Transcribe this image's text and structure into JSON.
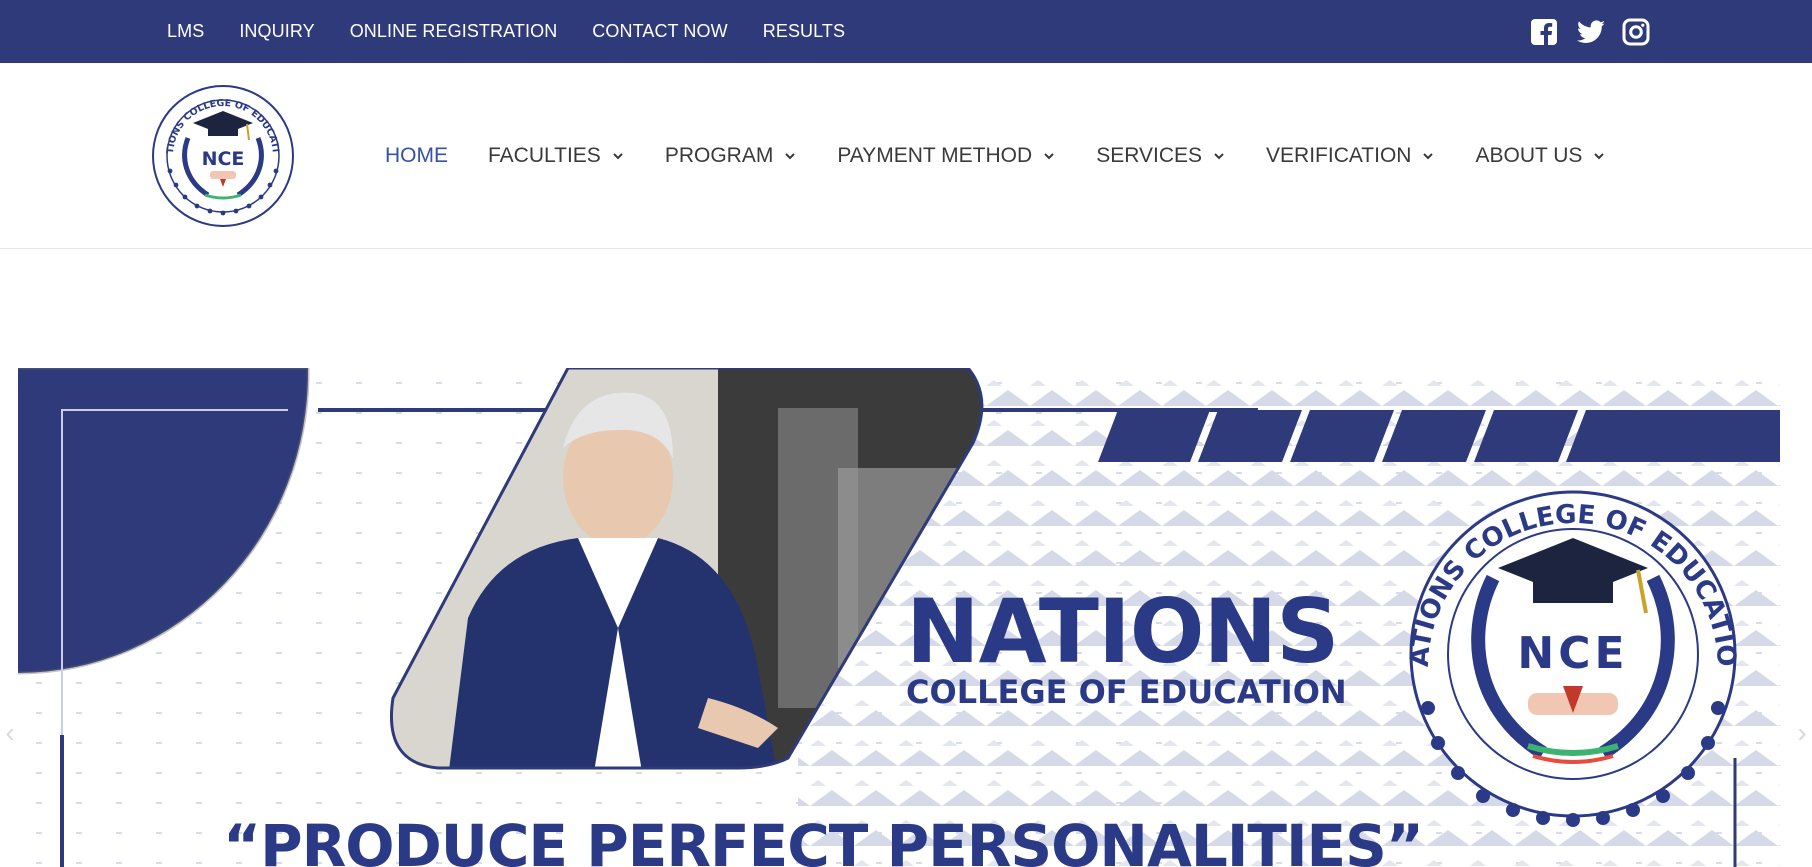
{
  "topbar": {
    "links": [
      "LMS",
      "INQUIRY",
      "ONLINE REGISTRATION",
      "CONTACT NOW",
      "RESULTS"
    ],
    "social": [
      "facebook-icon",
      "twitter-icon",
      "instagram-icon"
    ]
  },
  "header": {
    "logo": {
      "abbr": "NCE",
      "ring_text": "NATIONS COLLEGE OF EDUCATION"
    },
    "nav": [
      {
        "label": "HOME",
        "dropdown": false,
        "active": true
      },
      {
        "label": "FACULTIES",
        "dropdown": true
      },
      {
        "label": "PROGRAM",
        "dropdown": true
      },
      {
        "label": "PAYMENT METHOD",
        "dropdown": true
      },
      {
        "label": "SERVICES",
        "dropdown": true
      },
      {
        "label": "VERIFICATION",
        "dropdown": true
      },
      {
        "label": "ABOUT US",
        "dropdown": true
      }
    ]
  },
  "hero": {
    "title": "NATIONS",
    "subtitle": "COLLEGE OF EDUCATION",
    "slogan": "“PRODUCE PERFECT PERSONALITIES”",
    "seal_abbr": "NCE",
    "seal_ring_text": "NATIONS COLLEGE OF EDUCATION"
  },
  "colors": {
    "brand_navy": "#2e3a7a",
    "accent_blue": "#3452a8",
    "pattern": "#d6d9e8"
  }
}
